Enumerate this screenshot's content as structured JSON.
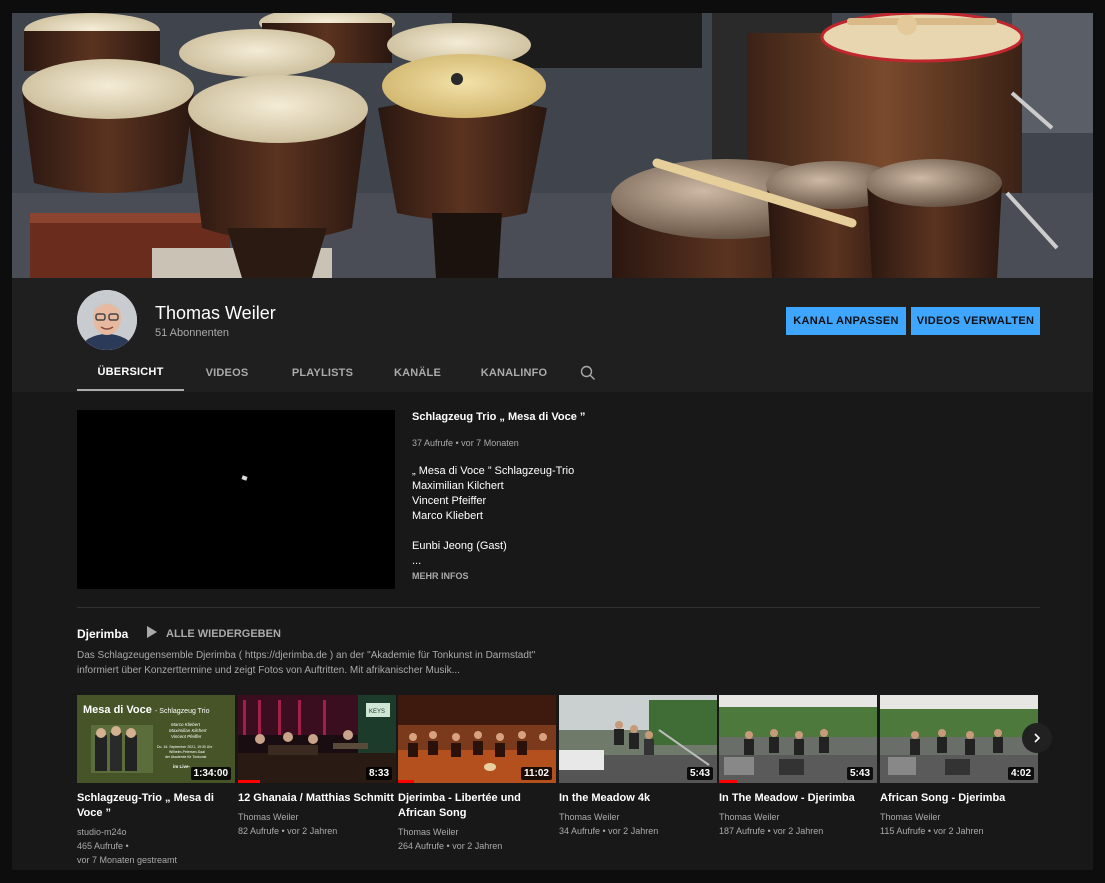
{
  "channel": {
    "name": "Thomas Weiler",
    "subscribers": "51 Abonnenten",
    "customize_label": "KANAL ANPASSEN",
    "manage_label": "VIDEOS VERWALTEN"
  },
  "tabs": [
    {
      "label": "ÜBERSICHT",
      "active": true
    },
    {
      "label": "VIDEOS"
    },
    {
      "label": "PLAYLISTS"
    },
    {
      "label": "KANÄLE"
    },
    {
      "label": "KANALINFO"
    }
  ],
  "icons": {
    "search": "search-icon",
    "play": "play-icon",
    "next": "chevron-right-icon"
  },
  "featured": {
    "title": "Schlagzeug Trio „ Mesa di Voce ”",
    "meta": "37 Aufrufe • vor 7 Monaten",
    "description": [
      "„ Mesa di Voce ” Schlagzeug-Trio",
      "Maximilian Kilchert",
      "Vincent Pfeiffer",
      "Marco Kliebert",
      "",
      "Eunbi Jeong (Gast)",
      "..."
    ],
    "more_label": "MEHR INFOS"
  },
  "section": {
    "title": "Djerimba",
    "play_all_label": "ALLE WIEDERGEBEN",
    "description": "Das Schlagzeugensemble Djerimba ( https://djerimba.de ) an der \"Akademie für Tonkunst in Darmstadt\" informiert über Konzerttermine und zeigt Fotos von Auftritten. Mit afrikanischer Musik..."
  },
  "videos": [
    {
      "title": "Schlagzeug-Trio „ Mesa di Voce ”",
      "channel": "studio-m24o",
      "meta": "465 Aufrufe •",
      "meta2": "vor 7 Monaten gestreamt",
      "duration": "1:34:00",
      "thumb_text": {
        "title": "Mesa di Voce",
        "subtitle": "- Schlagzeug Trio",
        "names": [
          "Marco Kliebert",
          "Maximilian Kilchert",
          "Vincent Pfeiffer"
        ],
        "info": [
          "Do. 16. September 2021, 19:30 Uhr",
          "Wilhelm-Petersen-Saal",
          "der Akademie für Tonkunst"
        ],
        "live": "im Live-"
      }
    },
    {
      "title": "12 Ghanaia / Matthias Schmitt",
      "channel": "Thomas Weiler",
      "meta": "82 Aufrufe • vor 2 Jahren",
      "duration": "8:33",
      "thumb_sign": "KEYS"
    },
    {
      "title": "Djerimba - Libertée und African Song",
      "channel": "Thomas Weiler",
      "meta": "264 Aufrufe • vor 2 Jahren",
      "duration": "11:02"
    },
    {
      "title": "In the Meadow 4k",
      "channel": "Thomas Weiler",
      "meta": "34 Aufrufe • vor 2 Jahren",
      "duration": "5:43"
    },
    {
      "title": "In The Meadow - Djerimba",
      "channel": "Thomas Weiler",
      "meta": "187 Aufrufe • vor 2 Jahren",
      "duration": "5:43"
    },
    {
      "title": "African Song - Djerimba",
      "channel": "Thomas Weiler",
      "meta": "115 Aufrufe • vor 2 Jahren",
      "duration": "4:02"
    }
  ],
  "colors": {
    "accent": "#3ea6ff",
    "background": "#181818",
    "header": "#1f1f1f",
    "progress": "#ff0000"
  }
}
